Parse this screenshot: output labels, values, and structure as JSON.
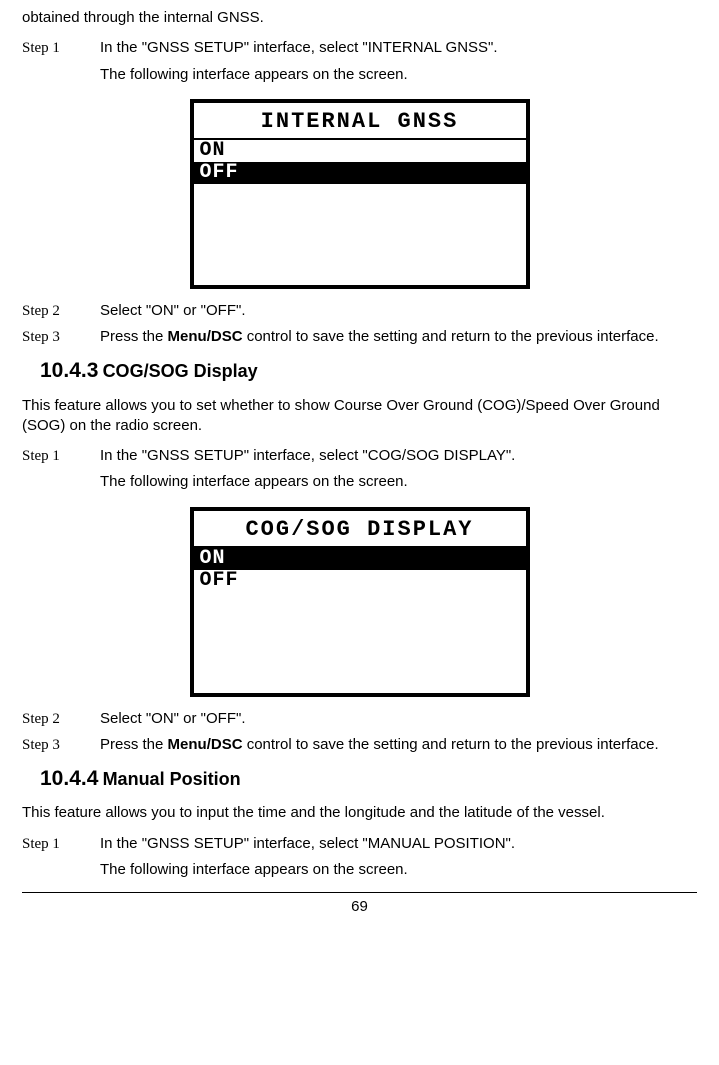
{
  "intro_top": "obtained through the internal GNSS.",
  "sec1": {
    "step1_label": "Step 1",
    "step1_line1": "In the \"GNSS SETUP\" interface, select \"INTERNAL GNSS\".",
    "step1_line2": "The following interface appears on the screen.",
    "screen_title": "INTERNAL GNSS",
    "opt_on": "ON",
    "opt_off": "OFF",
    "step2_label": "Step 2",
    "step2_text": "Select \"ON\" or \"OFF\".",
    "step3_label": "Step 3",
    "step3_prefix": "Press the ",
    "step3_bold": "Menu/DSC",
    "step3_suffix": " control to save the setting and return to the previous interface."
  },
  "h1_num": "10.4.3",
  "h1_text": "COG/SOG Display",
  "sec2": {
    "intro": "This feature allows you to set whether to show Course Over Ground (COG)/Speed Over Ground (SOG) on the radio screen.",
    "step1_label": "Step 1",
    "step1_line1": "In the \"GNSS SETUP\" interface, select \"COG/SOG DISPLAY\".",
    "step1_line2": "The following interface appears on the screen.",
    "screen_title": "COG/SOG DISPLAY",
    "opt_on": "ON",
    "opt_off": "OFF",
    "step2_label": "Step 2",
    "step2_text": "Select \"ON\" or \"OFF\".",
    "step3_label": "Step 3",
    "step3_prefix": "Press the ",
    "step3_bold": "Menu/DSC",
    "step3_suffix": " control to save the setting and return to the previous interface."
  },
  "h2_num": "10.4.4",
  "h2_text": "Manual Position",
  "sec3": {
    "intro": "This feature allows you to input the time and the longitude and the latitude of the vessel.",
    "step1_label": "Step 1",
    "step1_line1": "In the \"GNSS SETUP\" interface, select \"MANUAL POSITION\".",
    "step1_line2": "The following interface appears on the screen."
  },
  "page_number": "69"
}
